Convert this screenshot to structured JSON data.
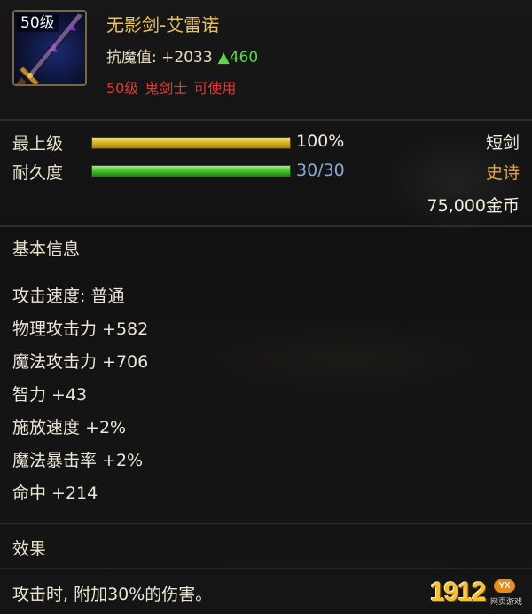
{
  "item": {
    "level_badge": "50级",
    "name": "无影剑-艾雷诺",
    "resist_label": "抗魔值: +2033",
    "resist_delta": "▲460",
    "requirements": [
      "50级",
      "鬼剑士",
      "可使用"
    ]
  },
  "bars": [
    {
      "label": "最上级",
      "value_text": "100%",
      "fill": 1.0,
      "style": "gold"
    },
    {
      "label": "耐久度",
      "value_text": "30/30",
      "fill": 1.0,
      "style": "green"
    }
  ],
  "info_right": {
    "weapon_type": "短剑",
    "rarity": "史诗",
    "price": "75,000金币"
  },
  "colors": {
    "rarity": "#e8a23a",
    "gold_text": "#e8c25a",
    "requirement_red": "#e03838",
    "delta_green": "#5cd64a"
  },
  "basic_info": {
    "title": "基本信息",
    "stats": [
      "攻击速度: 普通",
      "物理攻击力 +582",
      "魔法攻击力 +706",
      "智力 +43",
      "施放速度 +2%",
      "魔法暴击率 +2%",
      "命中 +214"
    ]
  },
  "effect": {
    "title": "效果",
    "text": "攻击时, 附加30%的伤害。"
  },
  "watermark": {
    "main": "1912",
    "badge": "YX",
    "sub": "网页游戏"
  }
}
